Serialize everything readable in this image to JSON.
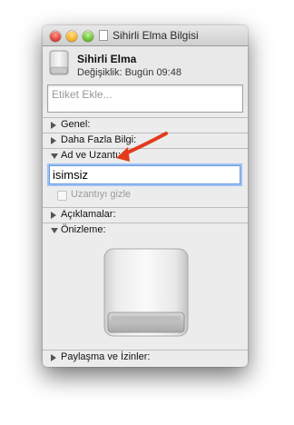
{
  "window": {
    "title": "Sihirli Elma Bilgisi",
    "icon": "document-icon",
    "controls": [
      "close",
      "minimize",
      "zoom"
    ]
  },
  "header": {
    "icon": "external-drive-icon",
    "name": "Sihirli Elma",
    "modified_label": "Değişiklik:",
    "modified_value": "Bugün 09:48"
  },
  "tags": {
    "placeholder": "Etiket Ekle..."
  },
  "sections": {
    "general": {
      "label": "Genel:",
      "expanded": false
    },
    "more_info": {
      "label": "Daha Fazla Bilgi:",
      "expanded": false
    },
    "name_extension": {
      "label": "Ad ve Uzantı:",
      "expanded": true
    },
    "comments": {
      "label": "Açıklamalar:",
      "expanded": false
    },
    "preview": {
      "label": "Önizleme:",
      "expanded": true
    },
    "sharing": {
      "label": "Paylaşma ve İzinler:",
      "expanded": false
    }
  },
  "name_extension": {
    "name_value": "isimsiz",
    "hide_extension_label": "Uzantıyı gizle",
    "hide_extension_checked": false
  },
  "annotation": {
    "arrow_color": "#e23b1c"
  },
  "colors": {
    "focus_ring": "#9dc1f3",
    "window_bg": "#ececec"
  }
}
